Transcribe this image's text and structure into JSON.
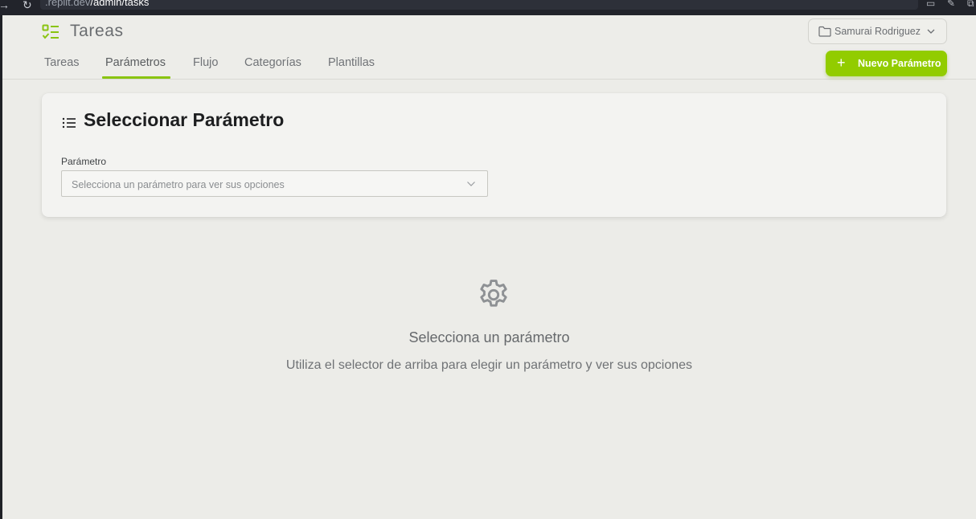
{
  "browser": {
    "url_domain": ".replit.dev",
    "url_path": "/admin/tasks"
  },
  "header": {
    "title": "Tareas",
    "user_name": "Samurai Rodriguez"
  },
  "tabs": [
    {
      "label": "Tareas"
    },
    {
      "label": "Parámetros",
      "active": true
    },
    {
      "label": "Flujo"
    },
    {
      "label": "Categorías"
    },
    {
      "label": "Plantillas"
    }
  ],
  "actions": {
    "new_button_label": "Nuevo Parámetro"
  },
  "card": {
    "title": "Seleccionar Parámetro",
    "field_label": "Parámetro",
    "select_placeholder": "Selecciona un parámetro para ver sus opciones"
  },
  "empty_state": {
    "title": "Selecciona un parámetro",
    "subtitle": "Utiliza el selector de arriba para elegir un parámetro y ver sus opciones"
  },
  "colors": {
    "accent": "#92cc00",
    "background": "#ecece8",
    "card": "#f3f3f1"
  }
}
